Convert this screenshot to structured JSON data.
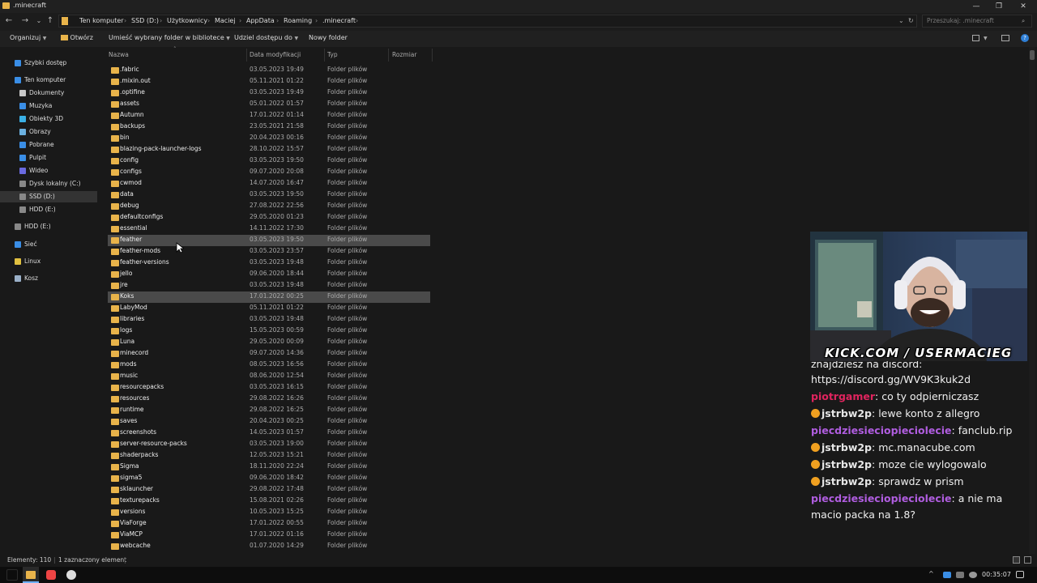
{
  "window": {
    "title": ".minecraft",
    "min": "—",
    "max": "❐",
    "close": "✕"
  },
  "nav": {
    "back": "←",
    "forward": "→",
    "recent": "⌄",
    "up": "↑"
  },
  "breadcrumb": [
    "Ten komputer",
    "SSD (D:)",
    "Użytkownicy",
    "Maciej",
    "AppData",
    "Roaming",
    ".minecraft"
  ],
  "search": {
    "placeholder": "Przeszukaj: .minecraft"
  },
  "toolbar": {
    "organize": "Organizuj",
    "open": "Otwórz",
    "include": "Umieść wybrany folder w bibliotece",
    "share": "Udziel dostępu do",
    "new_folder": "Nowy folder"
  },
  "sidebar": [
    {
      "label": "Szybki dostęp",
      "icon": "star-icon",
      "color": "#3a8ee6"
    },
    {
      "label": "Ten komputer",
      "icon": "computer-icon",
      "color": "#3a8ee6"
    },
    {
      "label": "Dokumenty",
      "icon": "documents-icon",
      "color": "#c8c8c8"
    },
    {
      "label": "Muzyka",
      "icon": "music-icon",
      "color": "#3a8ee6"
    },
    {
      "label": "Obiekty 3D",
      "icon": "objects-3d-icon",
      "color": "#3ab0e6"
    },
    {
      "label": "Obrazy",
      "icon": "pictures-icon",
      "color": "#6ab0e0"
    },
    {
      "label": "Pobrane",
      "icon": "downloads-icon",
      "color": "#3a8ee6"
    },
    {
      "label": "Pulpit",
      "icon": "desktop-icon",
      "color": "#3a8ee6"
    },
    {
      "label": "Wideo",
      "icon": "video-icon",
      "color": "#6a6ae0"
    },
    {
      "label": "Dysk lokalny (C:)",
      "icon": "drive-c-icon",
      "color": "#888888"
    },
    {
      "label": "SSD (D:)",
      "icon": "drive-d-icon",
      "color": "#888888"
    },
    {
      "label": "HDD (E:)",
      "icon": "drive-e-icon",
      "color": "#888888"
    },
    {
      "label": "HDD (E:)",
      "icon": "drive-e-icon",
      "color": "#888888"
    },
    {
      "label": "Sieć",
      "icon": "network-icon",
      "color": "#3a8ee6"
    },
    {
      "label": "Linux",
      "icon": "linux-icon",
      "color": "#e0c040"
    },
    {
      "label": "Kosz",
      "icon": "recycle-bin-icon",
      "color": "#9ab0c8"
    }
  ],
  "columns": {
    "name": "Nazwa",
    "date": "Data modyfikacji",
    "type": "Typ",
    "size": "Rozmiar"
  },
  "files": [
    {
      "name": ".fabric",
      "date": "03.05.2023 19:49",
      "type": "Folder plików"
    },
    {
      "name": ".mixin.out",
      "date": "05.11.2021 01:22",
      "type": "Folder plików"
    },
    {
      "name": ".optifine",
      "date": "03.05.2023 19:49",
      "type": "Folder plików"
    },
    {
      "name": "assets",
      "date": "05.01.2022 01:57",
      "type": "Folder plików"
    },
    {
      "name": "Autumn",
      "date": "17.01.2022 01:14",
      "type": "Folder plików"
    },
    {
      "name": "backups",
      "date": "23.05.2021 21:58",
      "type": "Folder plików"
    },
    {
      "name": "bin",
      "date": "20.04.2023 00:16",
      "type": "Folder plików"
    },
    {
      "name": "blazing-pack-launcher-logs",
      "date": "28.10.2022 15:57",
      "type": "Folder plików"
    },
    {
      "name": "config",
      "date": "03.05.2023 19:50",
      "type": "Folder plików"
    },
    {
      "name": "configs",
      "date": "09.07.2020 20:08",
      "type": "Folder plików"
    },
    {
      "name": "cwmod",
      "date": "14.07.2020 16:47",
      "type": "Folder plików"
    },
    {
      "name": "data",
      "date": "03.05.2023 19:50",
      "type": "Folder plików"
    },
    {
      "name": "debug",
      "date": "27.08.2022 22:56",
      "type": "Folder plików"
    },
    {
      "name": "defaultconfigs",
      "date": "29.05.2020 01:23",
      "type": "Folder plików"
    },
    {
      "name": "essential",
      "date": "14.11.2022 17:30",
      "type": "Folder plików"
    },
    {
      "name": "feather",
      "date": "03.05.2023 19:50",
      "type": "Folder plików",
      "hl": true
    },
    {
      "name": "feather-mods",
      "date": "03.05.2023 23:57",
      "type": "Folder plików"
    },
    {
      "name": "feather-versions",
      "date": "03.05.2023 19:48",
      "type": "Folder plików"
    },
    {
      "name": "jello",
      "date": "09.06.2020 18:44",
      "type": "Folder plików"
    },
    {
      "name": "jre",
      "date": "03.05.2023 19:48",
      "type": "Folder plików"
    },
    {
      "name": "Koks",
      "date": "17.01.2022 00:25",
      "type": "Folder plików",
      "hl": true
    },
    {
      "name": "LabyMod",
      "date": "05.11.2021 01:22",
      "type": "Folder plików"
    },
    {
      "name": "libraries",
      "date": "03.05.2023 19:48",
      "type": "Folder plików"
    },
    {
      "name": "logs",
      "date": "15.05.2023 00:59",
      "type": "Folder plików"
    },
    {
      "name": "Luna",
      "date": "29.05.2020 00:09",
      "type": "Folder plików"
    },
    {
      "name": "minecord",
      "date": "09.07.2020 14:36",
      "type": "Folder plików"
    },
    {
      "name": "mods",
      "date": "08.05.2023 16:56",
      "type": "Folder plików"
    },
    {
      "name": "music",
      "date": "08.06.2020 12:54",
      "type": "Folder plików"
    },
    {
      "name": "resourcepacks",
      "date": "03.05.2023 16:15",
      "type": "Folder plików"
    },
    {
      "name": "resources",
      "date": "29.08.2022 16:26",
      "type": "Folder plików"
    },
    {
      "name": "runtime",
      "date": "29.08.2022 16:25",
      "type": "Folder plików"
    },
    {
      "name": "saves",
      "date": "20.04.2023 00:25",
      "type": "Folder plików"
    },
    {
      "name": "screenshots",
      "date": "14.05.2023 01:57",
      "type": "Folder plików"
    },
    {
      "name": "server-resource-packs",
      "date": "03.05.2023 19:00",
      "type": "Folder plików"
    },
    {
      "name": "shaderpacks",
      "date": "12.05.2023 15:21",
      "type": "Folder plików"
    },
    {
      "name": "Sigma",
      "date": "18.11.2020 22:24",
      "type": "Folder plików"
    },
    {
      "name": "sigma5",
      "date": "09.06.2020 18:42",
      "type": "Folder plików"
    },
    {
      "name": "sklauncher",
      "date": "29.08.2022 17:48",
      "type": "Folder plików"
    },
    {
      "name": "texturepacks",
      "date": "15.08.2021 02:26",
      "type": "Folder plików"
    },
    {
      "name": "versions",
      "date": "10.05.2023 15:25",
      "type": "Folder plików"
    },
    {
      "name": "ViaForge",
      "date": "17.01.2022 00:55",
      "type": "Folder plików"
    },
    {
      "name": "ViaMCP",
      "date": "17.01.2022 01:16",
      "type": "Folder plików"
    },
    {
      "name": "webcache",
      "date": "01.07.2020 14:29",
      "type": "Folder plików"
    }
  ],
  "status": {
    "count": "Elementy: 110",
    "selected": "1 zaznaczony element"
  },
  "overlay": {
    "kick": "KICK.COM / USERMACIEG"
  },
  "chat": [
    {
      "user": "",
      "text": "znajdziesz na discord:",
      "user_color": "#ffffff",
      "badge": false
    },
    {
      "user": "",
      "text": "https://discord.gg/WV9K3kuk2d",
      "user_color": "#ffffff",
      "badge": false
    },
    {
      "user": "piotrgamer",
      "text": ": co ty odpierniczasz",
      "user_color": "#e0245e",
      "badge": false
    },
    {
      "user": "jstrbw2p",
      "text": ": lewe konto z allegro",
      "user_color": "#e6e6e6",
      "badge": true
    },
    {
      "user": "piecdziesieciopieciolecie",
      "text": ": fanclub.rip",
      "user_color": "#b05de0",
      "badge": false
    },
    {
      "user": "jstrbw2p",
      "text": ": mc.manacube.com",
      "user_color": "#e6e6e6",
      "badge": true
    },
    {
      "user": "jstrbw2p",
      "text": ": moze cie wylogowalo",
      "user_color": "#e6e6e6",
      "badge": true
    },
    {
      "user": "jstrbw2p",
      "text": ": sprawdz w prism",
      "user_color": "#e6e6e6",
      "badge": true
    },
    {
      "user": "piecdziesieciopieciolecie",
      "text": ":      a nie ma",
      "user_color": "#b05de0",
      "badge": false
    },
    {
      "user": "",
      "text": "macio packa na 1.8?",
      "user_color": "#ffffff",
      "badge": false
    }
  ],
  "taskbar": {
    "time": "00:35:07"
  }
}
